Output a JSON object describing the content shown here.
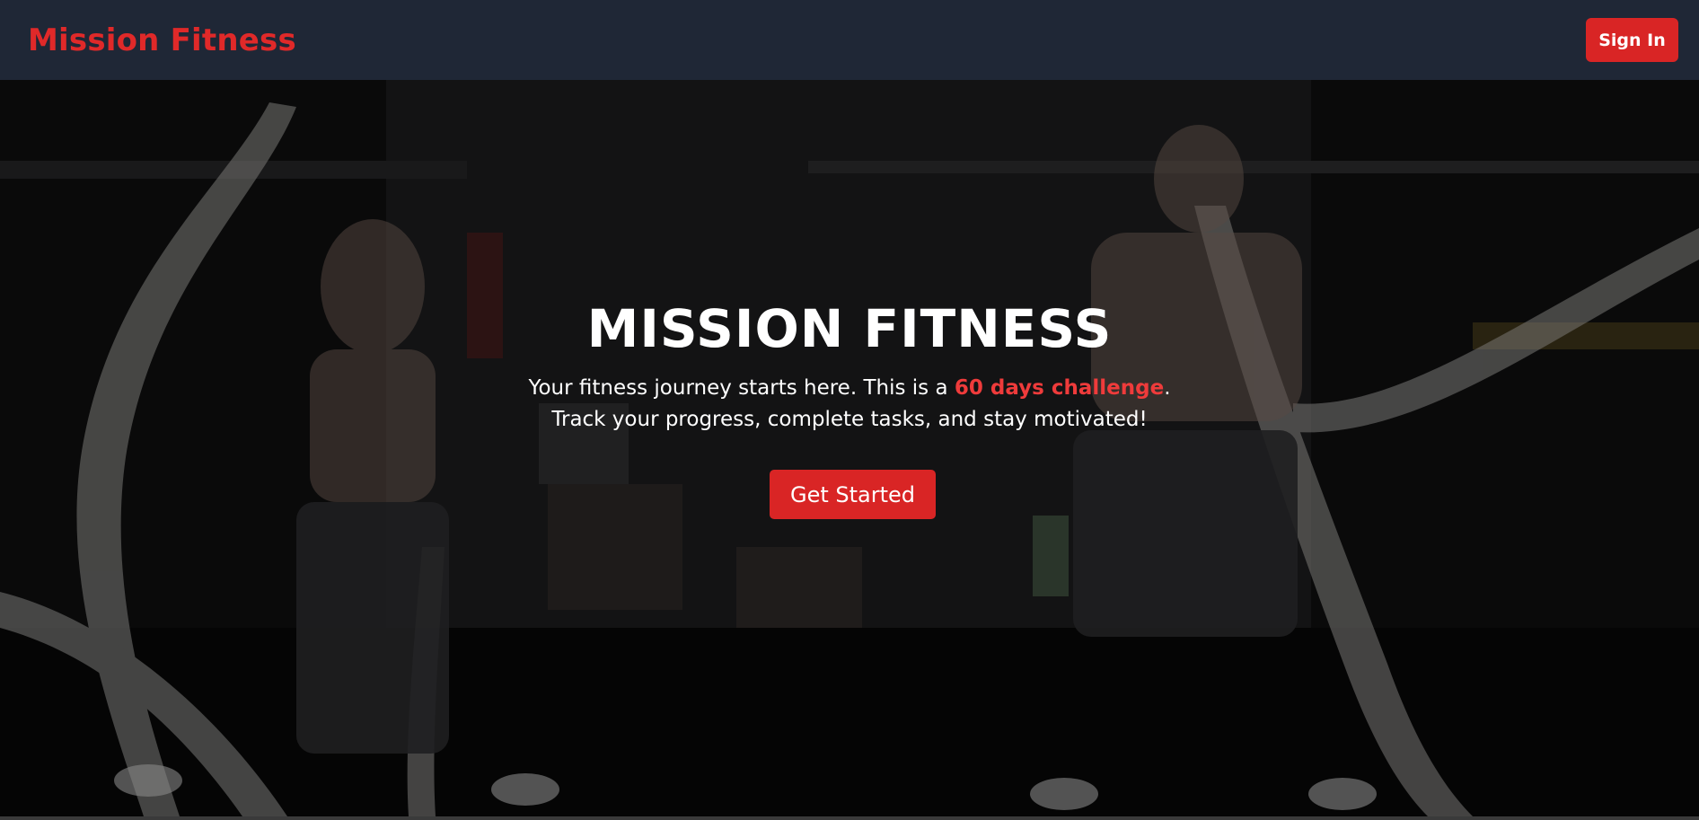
{
  "header": {
    "brand": "Mission Fitness",
    "signin_label": "Sign In"
  },
  "hero": {
    "title": "MISSION FITNESS",
    "line1_prefix": "Your fitness journey starts here. This is a ",
    "line1_highlight": "60 days challenge",
    "line1_suffix": ".",
    "line2": "Track your progress, complete tasks, and stay motivated!",
    "cta_label": "Get Started",
    "background_image": "gym-battle-ropes-photo"
  },
  "colors": {
    "navbar": "#1f2736",
    "accent": "#d92525",
    "highlight_text": "#ef3b3b"
  }
}
